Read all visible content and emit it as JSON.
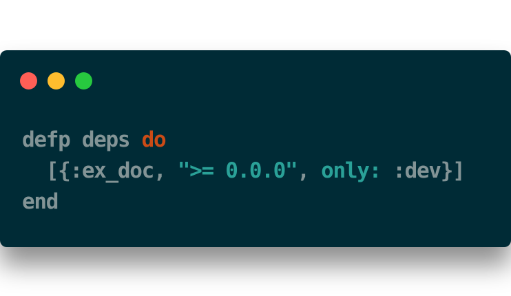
{
  "colors": {
    "background": "#002b36",
    "text": "#839496",
    "keyword": "#cb4b16",
    "string": "#2aa198",
    "close": "#ff5f56",
    "minimize": "#ffbd2e",
    "maximize": "#27c93f"
  },
  "window": {
    "controls": [
      {
        "name": "close-button-icon"
      },
      {
        "name": "minimize-button-icon"
      },
      {
        "name": "maximize-button-icon"
      }
    ]
  },
  "code": {
    "line1": {
      "def": "defp deps ",
      "kw": "do"
    },
    "line2": {
      "open": "  [{:ex_doc, ",
      "str": "\">= 0.0.0\"",
      "comma": ", ",
      "key": "only:",
      "rest": " :dev}]"
    },
    "line3": {
      "end": "end"
    }
  }
}
